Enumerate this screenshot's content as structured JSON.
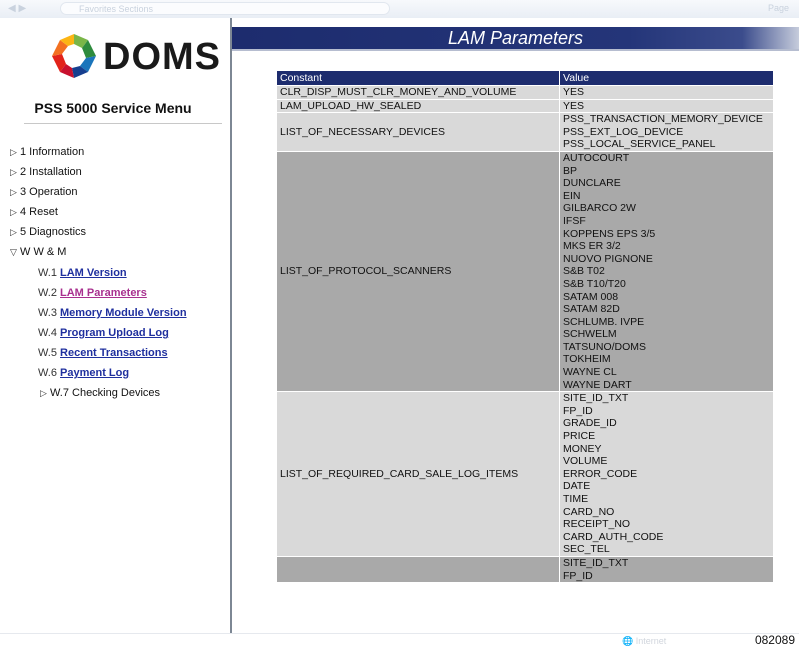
{
  "browser": {
    "address": "Favorites Sections",
    "tools": "Page"
  },
  "sidebar": {
    "logo_text": "DOMS",
    "title": "PSS 5000 Service Menu",
    "items": [
      {
        "label": "1 Information"
      },
      {
        "label": "2 Installation"
      },
      {
        "label": "3 Operation"
      },
      {
        "label": "4 Reset"
      },
      {
        "label": "5 Diagnostics"
      },
      {
        "label": "W W & M"
      }
    ],
    "subitems": [
      {
        "prefix": "W.1",
        "label": "LAM Version"
      },
      {
        "prefix": "W.2",
        "label": "LAM Parameters"
      },
      {
        "prefix": "W.3",
        "label": "Memory Module Version"
      },
      {
        "prefix": "W.4",
        "label": "Program Upload Log"
      },
      {
        "prefix": "W.5",
        "label": "Recent Transactions"
      },
      {
        "prefix": "W.6",
        "label": "Payment Log"
      },
      {
        "prefix": "",
        "label": "W.7 Checking Devices"
      }
    ]
  },
  "page": {
    "title": "LAM Parameters"
  },
  "table": {
    "headers": [
      "Constant",
      "Value"
    ],
    "rows": [
      {
        "constant": "CLR_DISP_MUST_CLR_MONEY_AND_VOLUME",
        "values": [
          "YES"
        ]
      },
      {
        "constant": "LAM_UPLOAD_HW_SEALED",
        "values": [
          "YES"
        ]
      },
      {
        "constant": "LIST_OF_NECESSARY_DEVICES",
        "values": [
          "PSS_TRANSACTION_MEMORY_DEVICE",
          "PSS_EXT_LOG_DEVICE",
          "PSS_LOCAL_SERVICE_PANEL"
        ]
      },
      {
        "constant": "LIST_OF_PROTOCOL_SCANNERS",
        "values": [
          "AUTOCOURT",
          "BP",
          "DUNCLARE",
          "EIN",
          "GILBARCO 2W",
          "IFSF",
          "KOPPENS EPS 3/5",
          "MKS ER 3/2",
          "NUOVO PIGNONE",
          "S&B T02",
          "S&B T10/T20",
          "SATAM 008",
          "SATAM 82D",
          "SCHLUMB. IVPE",
          "SCHWELM",
          "TATSUNO/DOMS",
          "TOKHEIM",
          "WAYNE CL",
          "WAYNE DART"
        ]
      },
      {
        "constant": "LIST_OF_REQUIRED_CARD_SALE_LOG_ITEMS",
        "values": [
          "SITE_ID_TXT",
          "FP_ID",
          "GRADE_ID",
          "PRICE",
          "MONEY",
          "VOLUME",
          "ERROR_CODE",
          "DATE",
          "TIME",
          "CARD_NO",
          "RECEIPT_NO",
          "CARD_AUTH_CODE",
          "SEC_TEL"
        ]
      },
      {
        "constant": "",
        "values": [
          "SITE_ID_TXT",
          "FP_ID"
        ]
      }
    ]
  },
  "status": {
    "zone": "Internet",
    "figure_number": "082089"
  }
}
